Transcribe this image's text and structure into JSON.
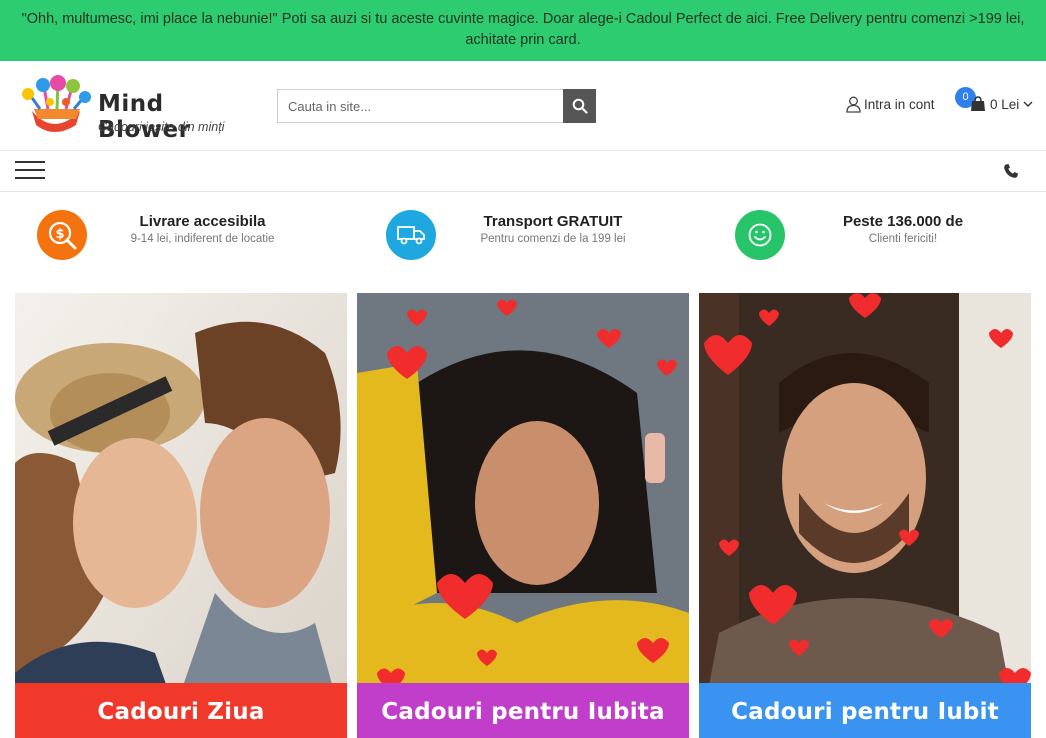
{
  "promo": {
    "text": "\"Ohh, multumesc, imi place la nebunie!\" Poti sa auzi si tu aceste cuvinte magice. Doar alege-i Cadoul Perfect de aici. Free Delivery pentru comenzi >199 lei, achitate prin card."
  },
  "header": {
    "logo_name": "Mind Blower",
    "logo_tagline": "Cadouri ieșite din minți",
    "search_placeholder": "Cauta in site...",
    "account_label": "Intra in cont",
    "cart_count": "0",
    "cart_total": "0 Lei"
  },
  "features": [
    {
      "title": "Livrare accesibila",
      "subtitle": "9-14 lei, indiferent de locatie",
      "icon": "money-search-icon",
      "color": "#f5730f"
    },
    {
      "title": "Transport GRATUIT",
      "subtitle": "Pentru comenzi de la 199 lei",
      "icon": "truck-icon",
      "color": "#1fa8e0"
    },
    {
      "title": "Peste 136.000 de",
      "subtitle": "Clienti fericiti!",
      "icon": "smiley-icon",
      "color": "#27c46a"
    }
  ],
  "cards": [
    {
      "label": "Cadouri Ziua Îndrăgostiților",
      "color": "#f0392b"
    },
    {
      "label": "Cadouri pentru Iubita",
      "color": "#c03ec9"
    },
    {
      "label": "Cadouri pentru Iubit",
      "color": "#3a93f0"
    }
  ]
}
